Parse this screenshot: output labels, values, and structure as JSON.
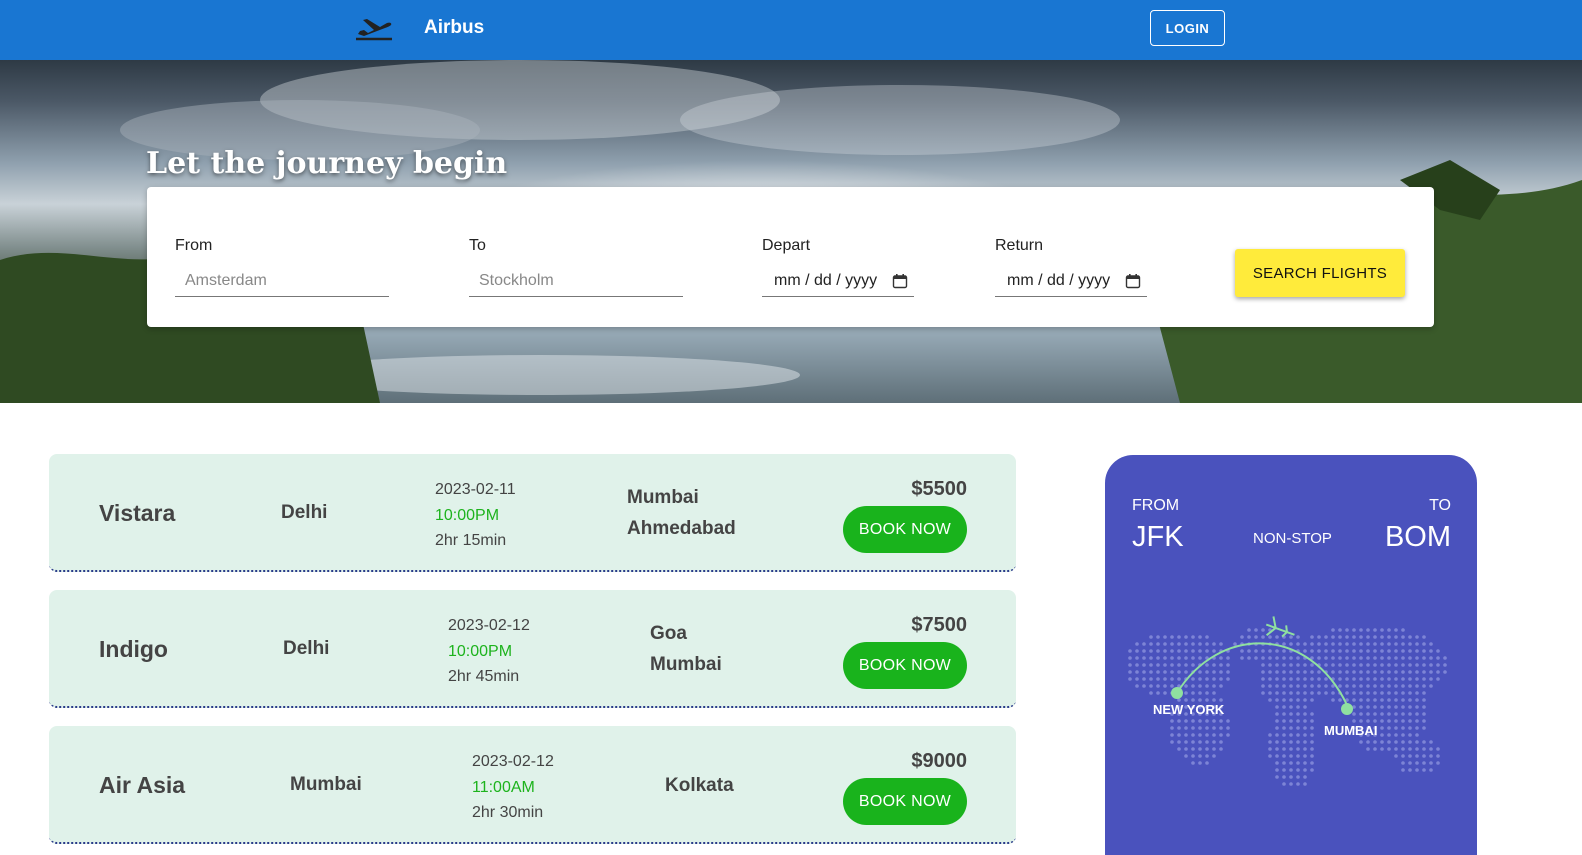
{
  "app": {
    "name": "Airbus",
    "login_label": "LOGIN"
  },
  "hero": {
    "title": "Let the journey begin"
  },
  "search": {
    "from_label": "From",
    "from_placeholder": "Amsterdam",
    "to_label": "To",
    "to_placeholder": "Stockholm",
    "depart_label": "Depart",
    "depart_value": "mm / dd / yyyy",
    "return_label": "Return",
    "return_value": "mm / dd / yyyy",
    "button_label": "SEARCH FLIGHTS"
  },
  "flights": [
    {
      "airline": "Vistara",
      "origin": "Delhi",
      "date": "2023-02-11",
      "time": "10:00PM",
      "duration": "2hr 15min",
      "stops": [
        "Mumbai",
        "Ahmedabad"
      ],
      "price": "$5500",
      "book_label": "BOOK NOW"
    },
    {
      "airline": "Indigo",
      "origin": "Delhi",
      "date": "2023-02-12",
      "time": "10:00PM",
      "duration": "2hr 45min",
      "stops": [
        "Goa",
        "Mumbai"
      ],
      "price": "$7500",
      "book_label": "BOOK NOW"
    },
    {
      "airline": "Air Asia",
      "origin": "Mumbai",
      "date": "2023-02-12",
      "time": "11:00AM",
      "duration": "2hr 30min",
      "stops": [
        "Kolkata"
      ],
      "price": "$9000",
      "book_label": "BOOK NOW"
    }
  ],
  "boarding_pass": {
    "from_label": "FROM",
    "to_label": "TO",
    "from_code": "JFK",
    "to_code": "BOM",
    "route_type": "NON-STOP",
    "origin_city": "NEW YORK",
    "destination_city": "MUMBAI"
  },
  "colors": {
    "topbar": "#1976d2",
    "search_button": "#ffeb3b",
    "book_button": "#19b31c",
    "time_text": "#1db31d",
    "card_bg": "#e0f2ea",
    "pass_bg": "#4a52bd"
  },
  "icons": {
    "brand": "airplane-takeoff-icon",
    "date": "calendar-icon"
  }
}
